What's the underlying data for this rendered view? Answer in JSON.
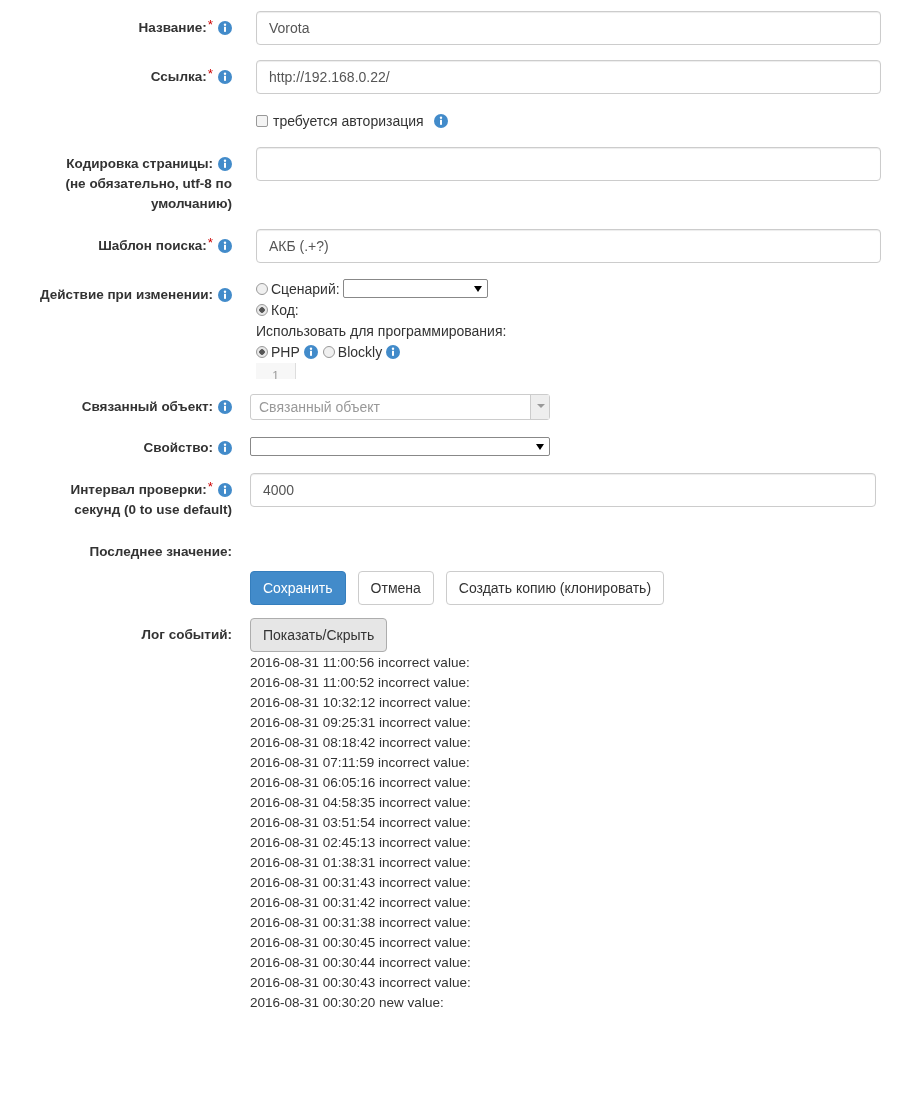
{
  "fields": [
    {
      "kind": "text",
      "label": "Название:",
      "required_mark": "*",
      "info": true,
      "value": "Vorota"
    },
    {
      "kind": "text",
      "label": "Ссылка:",
      "required_mark": "*",
      "info": true,
      "value": "http://192.168.0.22/"
    },
    {
      "kind": "checkbox",
      "text": "требуется авторизация",
      "checked": false,
      "info": true
    },
    {
      "kind": "text",
      "label": "Кодировка страницы:",
      "note": "(не обязательно, utf-8 по умолчанию)",
      "info": true
    },
    {
      "kind": "text",
      "label": "Шаблон поиска:",
      "required_mark": "*",
      "info": true,
      "value": "АКБ (.+?)"
    },
    {
      "kind": "action",
      "label": "Действие при изменении:",
      "info": true,
      "options": [
        {
          "label": "Сценарий:",
          "selected": false
        },
        {
          "label": "Код:",
          "selected": true
        }
      ],
      "language_label": "Использовать для программирования:",
      "languages": [
        {
          "label": "PHP",
          "selected": true,
          "info": true
        },
        {
          "label": "Blockly",
          "selected": false,
          "info": true
        }
      ],
      "editor_line": "1"
    },
    {
      "kind": "combo",
      "label": "Связанный объект:",
      "info": true,
      "placeholder": "Связанный объект"
    },
    {
      "kind": "select",
      "label": "Свойство:",
      "info": true
    },
    {
      "kind": "text",
      "label": "Интервал проверки:",
      "note": "секунд (0 to use default)",
      "required_mark": "*",
      "info": true,
      "value": "4000"
    },
    {
      "kind": "static",
      "label": "Последнее значение:"
    }
  ],
  "buttons": [
    {
      "label": "Сохранить",
      "primary": true
    },
    {
      "label": "Отмена",
      "primary": false
    },
    {
      "label": "Создать копию (клонировать)",
      "primary": false
    }
  ],
  "log": {
    "label": "Лог событий:",
    "toggle": "Показать/Скрыть",
    "entries": [
      "2016-08-31 11:00:56 incorrect value:",
      "2016-08-31 11:00:52 incorrect value:",
      "2016-08-31 10:32:12 incorrect value:",
      "2016-08-31 09:25:31 incorrect value:",
      "2016-08-31 08:18:42 incorrect value:",
      "2016-08-31 07:11:59 incorrect value:",
      "2016-08-31 06:05:16 incorrect value:",
      "2016-08-31 04:58:35 incorrect value:",
      "2016-08-31 03:51:54 incorrect value:",
      "2016-08-31 02:45:13 incorrect value:",
      "2016-08-31 01:38:31 incorrect value:",
      "2016-08-31 00:31:43 incorrect value:",
      "2016-08-31 00:31:42 incorrect value:",
      "2016-08-31 00:31:38 incorrect value:",
      "2016-08-31 00:30:45 incorrect value:",
      "2016-08-31 00:30:44 incorrect value:",
      "2016-08-31 00:30:43 incorrect value:",
      "2016-08-31 00:30:20 new value:"
    ]
  }
}
